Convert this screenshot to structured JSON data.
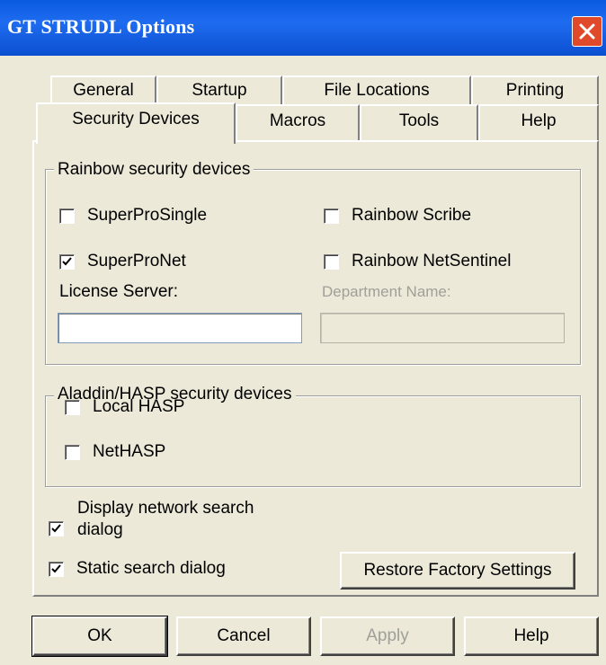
{
  "window": {
    "title": "GT STRUDL Options"
  },
  "tabs": {
    "row1": [
      "General",
      "Startup",
      "File Locations",
      "Printing"
    ],
    "row2": [
      "Security Devices",
      "Macros",
      "Tools",
      "Help"
    ],
    "active": "Security Devices"
  },
  "rainbow": {
    "legend": "Rainbow security devices",
    "superpro_single": {
      "label": "SuperProSingle",
      "checked": false
    },
    "rainbow_scribe": {
      "label": "Rainbow Scribe",
      "checked": false
    },
    "superpro_net": {
      "label": "SuperProNet",
      "checked": true
    },
    "rainbow_netsentinel": {
      "label": "Rainbow NetSentinel",
      "checked": false
    },
    "license_server_label": "License Server:",
    "license_server_value": "",
    "department_name_label": "Department Name:",
    "department_name_value": ""
  },
  "aladdin": {
    "legend": "Aladdin/HASP security devices",
    "local_hasp": {
      "label": "Local HASP",
      "checked": false
    },
    "net_hasp": {
      "label": "NetHASP",
      "checked": false
    }
  },
  "options": {
    "display_network_search": {
      "label_line1": "Display network search",
      "label_line2": "dialog",
      "checked": true
    },
    "static_search": {
      "label": "Static search dialog",
      "checked": true
    },
    "restore_button": "Restore Factory Settings"
  },
  "buttons": {
    "ok": "OK",
    "cancel": "Cancel",
    "apply": "Apply",
    "help": "Help"
  },
  "colors": {
    "titlebar": "#0a5ae0",
    "close": "#e04a2a",
    "face": "#ece9d8",
    "check": "#21a121"
  }
}
